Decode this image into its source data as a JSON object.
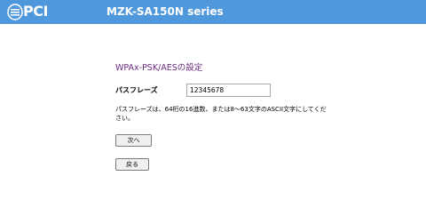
{
  "header": {
    "brand": "PCI",
    "product": "MZK-SA150N series",
    "logo_icon": "pci-logo-icon"
  },
  "form": {
    "title": "WPAx-PSK/AESの設定",
    "passphrase_label": "パスフレーズ",
    "passphrase_value": "12345678",
    "description": "パスフレーズは、64桁の16進数、または8～63文字のASCII文字にしてください。"
  },
  "buttons": {
    "next_label": "次へ",
    "back_label": "戻る"
  },
  "colors": {
    "header_bg": "#4f98dc",
    "title_color": "#6a2b80"
  }
}
